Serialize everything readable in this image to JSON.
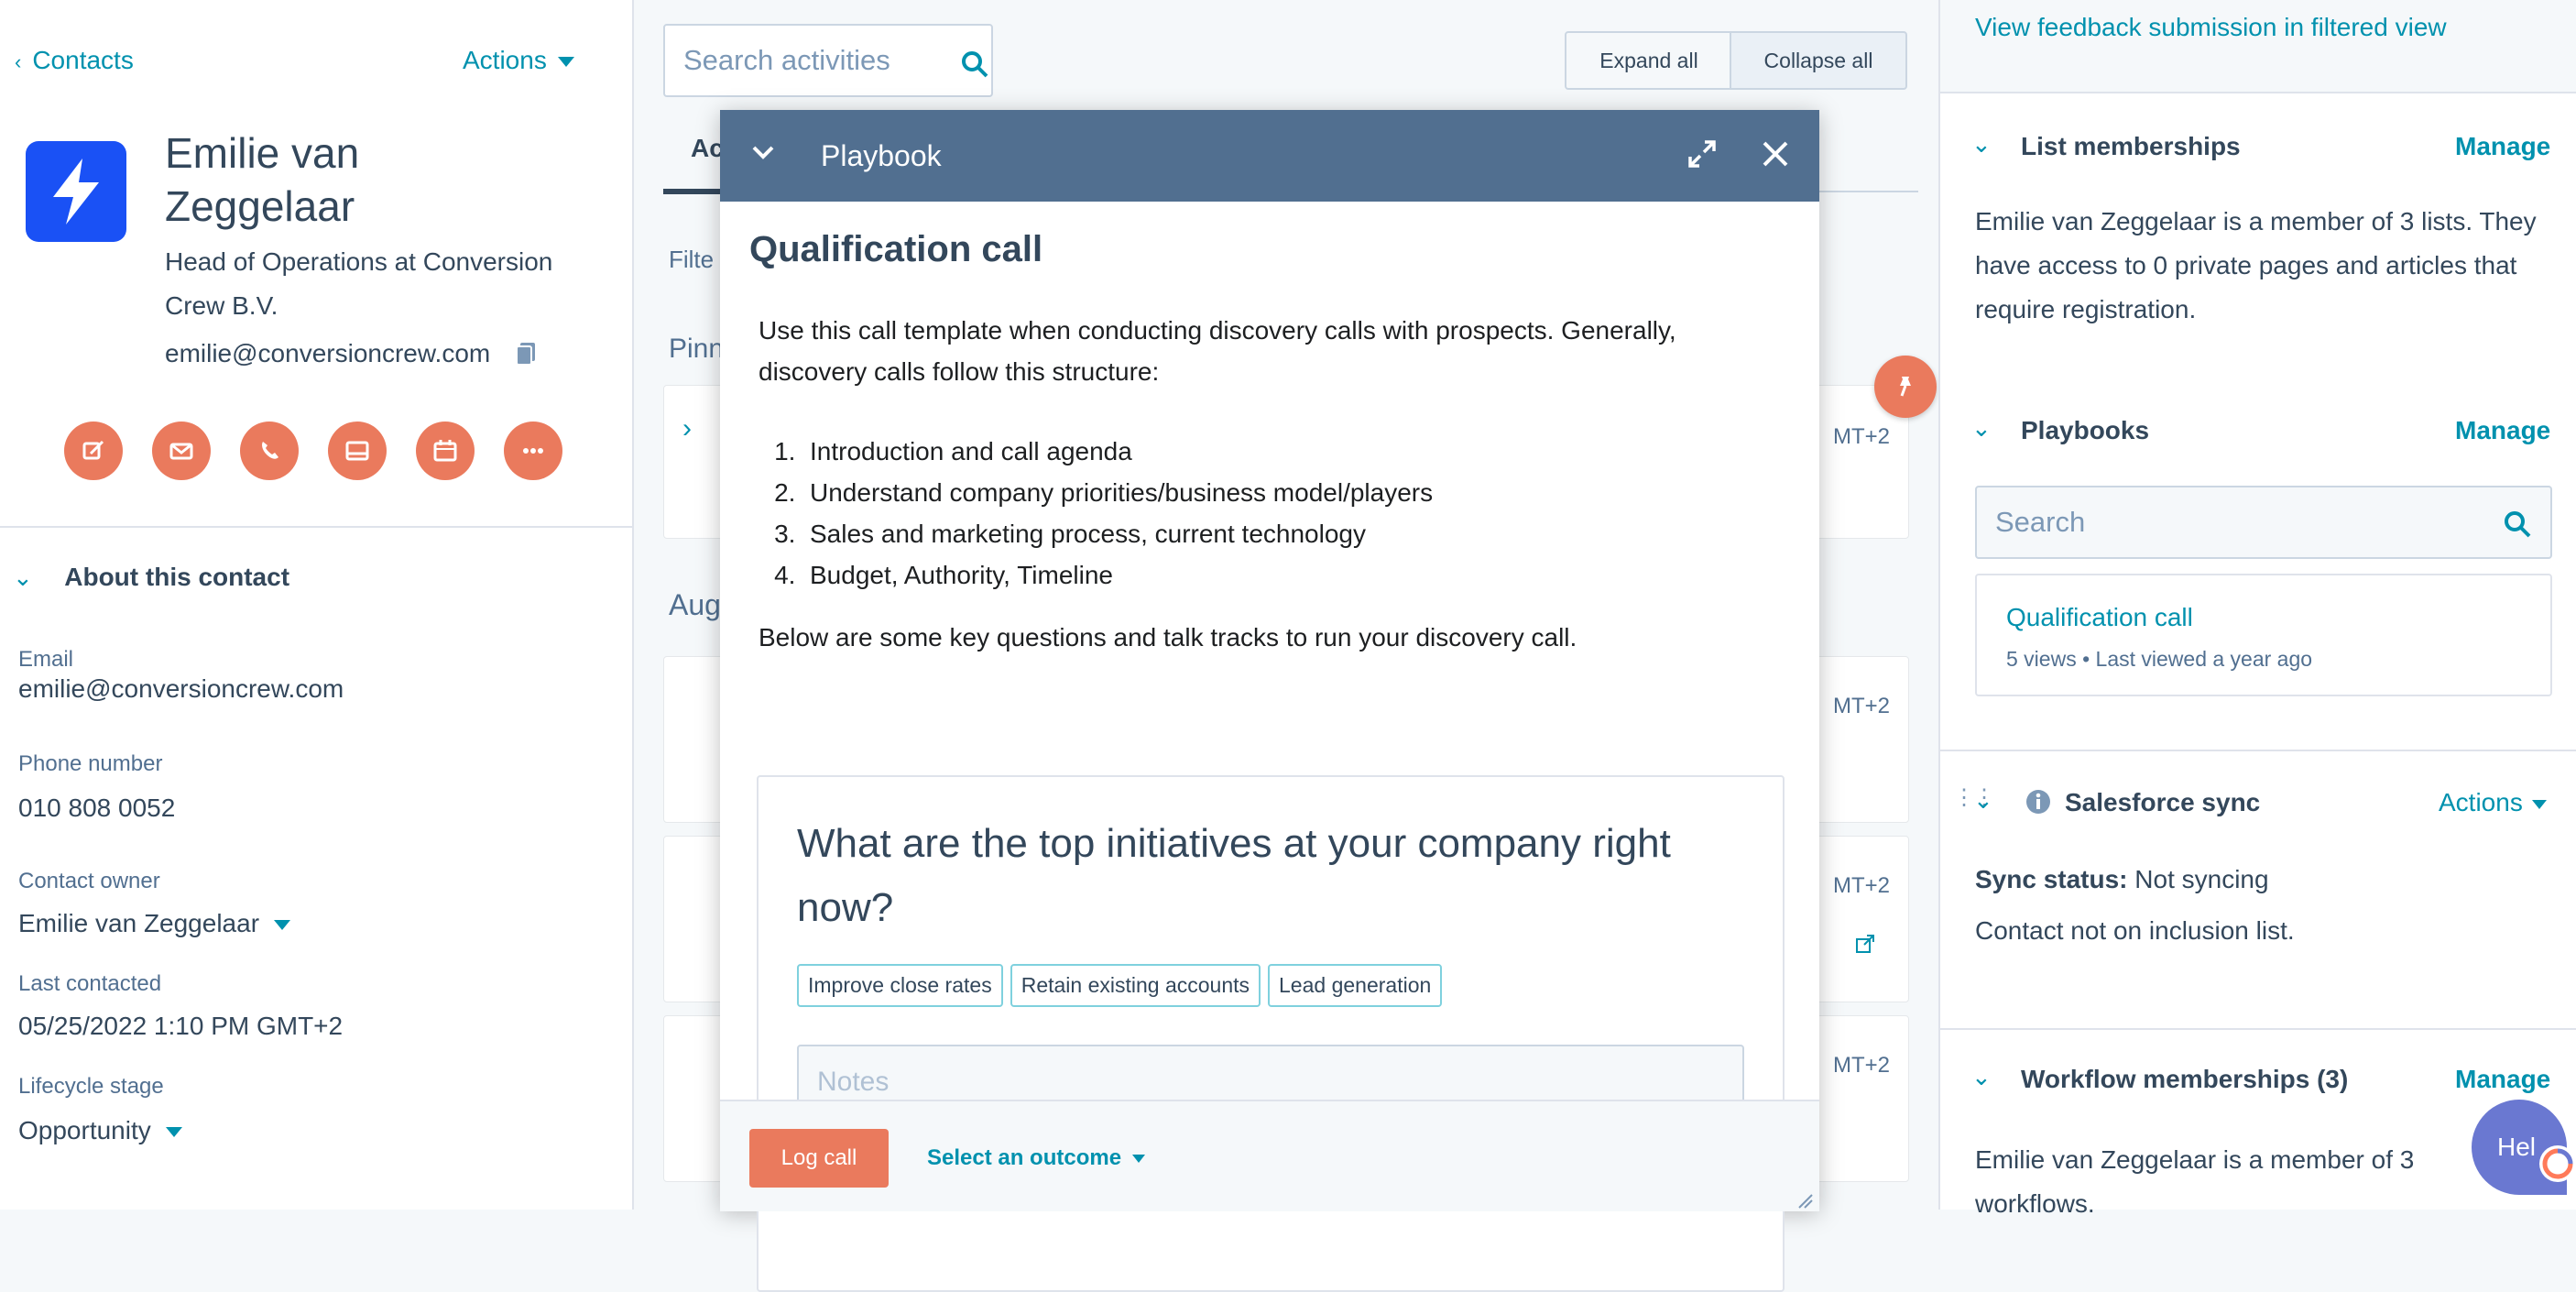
{
  "left": {
    "back_label": "Contacts",
    "actions_label": "Actions",
    "contact_name": "Emilie van Zeggelaar",
    "contact_title": "Head of Operations at Conversion Crew B.V.",
    "contact_email": "emilie@conversioncrew.com",
    "about_title": "About this contact",
    "fields": [
      {
        "label": "Email",
        "value": "emilie@conversioncrew.com"
      },
      {
        "label": "Phone number",
        "value": "010 808 0052"
      },
      {
        "label": "Contact owner",
        "value": "Emilie van Zeggelaar"
      },
      {
        "label": "Last contacted",
        "value": "05/25/2022 1:10 PM GMT+2"
      },
      {
        "label": "Lifecycle stage",
        "value": "Opportunity"
      }
    ]
  },
  "middle": {
    "search_placeholder": "Search activities",
    "expand_all": "Expand all",
    "collapse_all": "Collapse all",
    "tab_partial": "Ac",
    "filter_partial": "Filte",
    "pinned_partial": "Pinn",
    "month_partial": "Aug",
    "tz_labels": [
      "MT+2",
      "MT+2",
      "MT+2",
      "MT+2"
    ]
  },
  "modal": {
    "title": "Playbook",
    "heading": "Qualification call",
    "intro": "Use this call template when conducting discovery calls with prospects. Generally, discovery calls follow this structure:",
    "steps": [
      "Introduction and call agenda",
      "Understand company priorities/business model/players",
      "Sales and marketing process, current technology",
      "Budget, Authority, Timeline"
    ],
    "outro": "Below are some key questions and talk tracks to run your discovery call.",
    "question": "What are the top initiatives at your company right now?",
    "tags": [
      "Improve close rates",
      "Retain existing accounts",
      "Lead generation"
    ],
    "notes_placeholder": "Notes",
    "log_call": "Log call",
    "select_outcome": "Select an outcome"
  },
  "right": {
    "feedback_link": "View feedback submission in filtered view",
    "list_title": "List memberships",
    "manage": "Manage",
    "list_text": "Emilie van Zeggelaar is a member of 3 lists. They have access to 0 private pages and articles that require registration.",
    "playbooks_title": "Playbooks",
    "playbooks_search_placeholder": "Search",
    "playbook_item_title": "Qualification call",
    "playbook_item_meta": "5 views • Last viewed a year ago",
    "sf_title": "Salesforce sync",
    "sf_actions": "Actions",
    "sync_status_label": "Sync status:",
    "sync_status_value": "Not syncing",
    "sync_note": "Contact not on inclusion list.",
    "workflow_title": "Workflow memberships (3)",
    "workflow_text": "Emilie van Zeggelaar is a member of 3 workflows.",
    "help_label": "Hel"
  },
  "colors": {
    "accent": "#0091ae",
    "action_orange": "#ea7a5d",
    "modal_header": "#516f90",
    "logo_blue": "#1a51f5"
  }
}
